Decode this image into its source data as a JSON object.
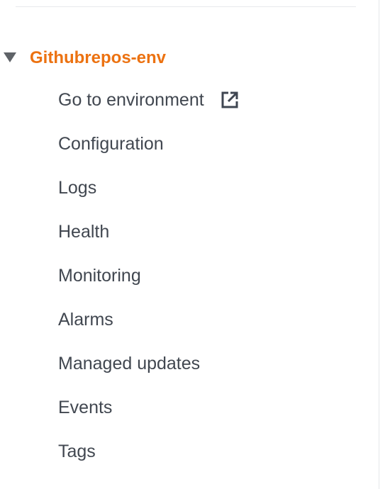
{
  "environment": {
    "name": "Githubrepos-env",
    "accent_color": "#ec7211",
    "caret_icon": "triangle-down-icon"
  },
  "nav": {
    "items": [
      {
        "label": "Go to environment",
        "icon": "external-link-icon"
      },
      {
        "label": "Configuration"
      },
      {
        "label": "Logs"
      },
      {
        "label": "Health"
      },
      {
        "label": "Monitoring"
      },
      {
        "label": "Alarms"
      },
      {
        "label": "Managed updates"
      },
      {
        "label": "Events"
      },
      {
        "label": "Tags"
      }
    ]
  }
}
